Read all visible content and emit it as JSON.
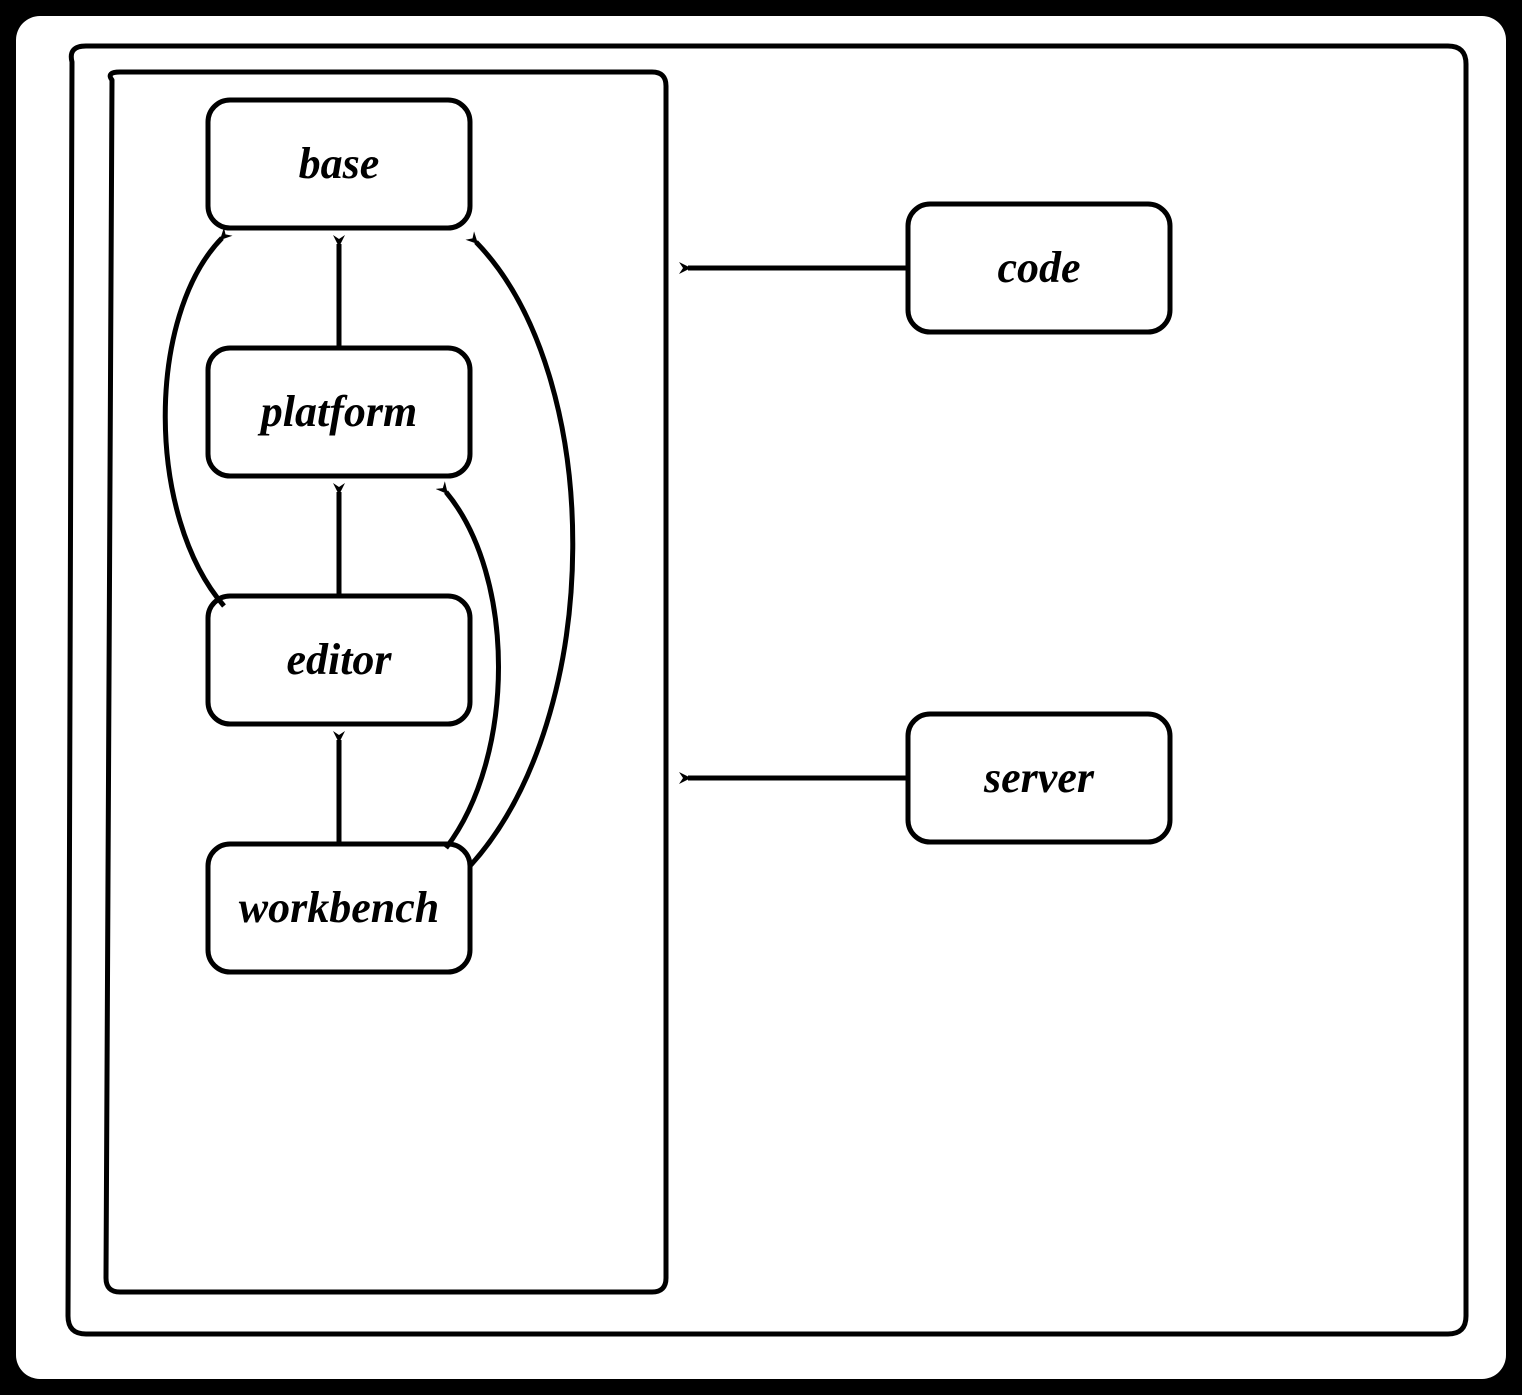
{
  "diagram": {
    "nodes": {
      "base": {
        "label": "base"
      },
      "platform": {
        "label": "platform"
      },
      "editor": {
        "label": "editor"
      },
      "workbench": {
        "label": "workbench"
      },
      "code": {
        "label": "code"
      },
      "server": {
        "label": "server"
      }
    },
    "containers": {
      "outer": {
        "contains": [
          "inner",
          "code",
          "server"
        ]
      },
      "inner": {
        "contains": [
          "base",
          "platform",
          "editor",
          "workbench"
        ]
      }
    },
    "edges": [
      {
        "from": "platform",
        "to": "base",
        "style": "straight"
      },
      {
        "from": "editor",
        "to": "platform",
        "style": "straight"
      },
      {
        "from": "workbench",
        "to": "editor",
        "style": "straight"
      },
      {
        "from": "editor",
        "to": "base",
        "style": "curved-left"
      },
      {
        "from": "workbench",
        "to": "platform",
        "style": "curved-right"
      },
      {
        "from": "workbench",
        "to": "base",
        "style": "curved-right-outer"
      },
      {
        "from": "code",
        "to": "inner",
        "style": "straight"
      },
      {
        "from": "server",
        "to": "inner",
        "style": "straight"
      }
    ],
    "style": {
      "stroke": "#000000",
      "strokeWidth": 4,
      "fontSizeSmall": 40,
      "fontSizeNode": 44
    }
  }
}
